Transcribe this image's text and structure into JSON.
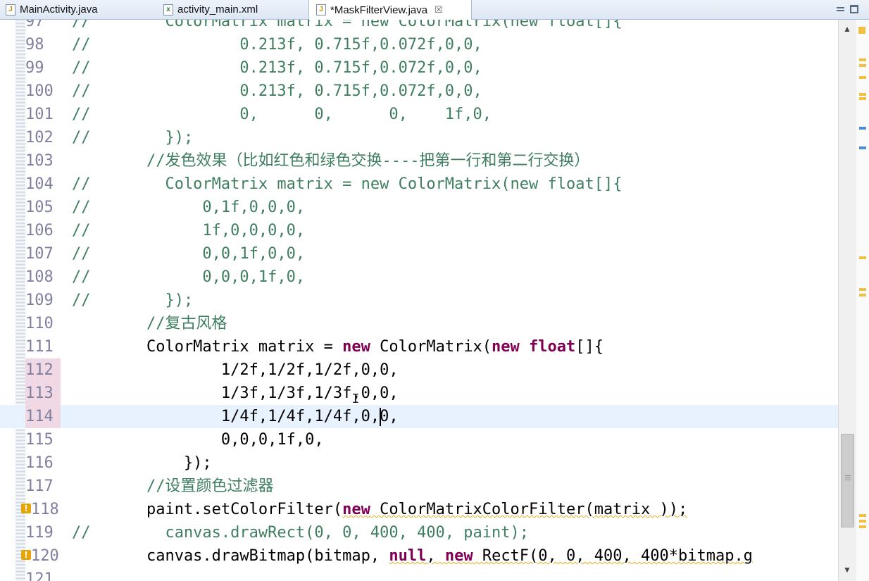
{
  "tabs": [
    {
      "label": "MainActivity.java",
      "icon": "java-file-icon",
      "active": false
    },
    {
      "label": "activity_main.xml",
      "icon": "xml-file-icon",
      "active": false
    },
    {
      "label": "*MaskFilterView.java",
      "icon": "java-file-icon",
      "active": true,
      "close_glyph": "☒"
    }
  ],
  "editor": {
    "font": "monospace",
    "colors": {
      "comment": "#3f7f5f",
      "keyword": "#7f0055",
      "current_line": "#e8f2fe",
      "line_number": "#7f7f9f"
    },
    "current_line_number": "114",
    "lines": [
      {
        "n": "97",
        "prefix": "//",
        "code": "        ColorMatrix matrix = new ColorMatrix(new float[]{"
      },
      {
        "n": "98",
        "prefix": "//",
        "code": "                0.213f, 0.715f,0.072f,0,0,"
      },
      {
        "n": "99",
        "prefix": "//",
        "code": "                0.213f, 0.715f,0.072f,0,0,"
      },
      {
        "n": "100",
        "prefix": "//",
        "code": "                0.213f, 0.715f,0.072f,0,0,"
      },
      {
        "n": "101",
        "prefix": "//",
        "code": "                0,      0,      0,    1f,0,"
      },
      {
        "n": "102",
        "prefix": "//",
        "code": "        });"
      },
      {
        "n": "103",
        "prefix": "",
        "code": "        //发色效果（比如红色和绿色交换----把第一行和第二行交换）"
      },
      {
        "n": "104",
        "prefix": "//",
        "code": "        ColorMatrix matrix = new ColorMatrix(new float[]{"
      },
      {
        "n": "105",
        "prefix": "//",
        "code": "            0,1f,0,0,0,"
      },
      {
        "n": "106",
        "prefix": "//",
        "code": "            1f,0,0,0,0,"
      },
      {
        "n": "107",
        "prefix": "//",
        "code": "            0,0,1f,0,0,"
      },
      {
        "n": "108",
        "prefix": "//",
        "code": "            0,0,0,1f,0,"
      },
      {
        "n": "109",
        "prefix": "//",
        "code": "        });"
      },
      {
        "n": "110",
        "prefix": "",
        "code": "        //复古风格"
      },
      {
        "n": "111",
        "prefix": "",
        "code_parts": [
          "        ColorMatrix matrix = ",
          "new",
          " ColorMatrix(",
          "new",
          " ",
          "float",
          "[]{"
        ]
      },
      {
        "n": "112",
        "prefix": "",
        "code": "                1/2f,1/2f,1/2f,0,0,"
      },
      {
        "n": "113",
        "prefix": "",
        "code": "                1/3f,1/3f,1/3f,0,0,"
      },
      {
        "n": "114",
        "prefix": "",
        "code": "                1/4f,1/4f,1/4f,0,0,"
      },
      {
        "n": "115",
        "prefix": "",
        "code": "                0,0,0,1f,0,"
      },
      {
        "n": "116",
        "prefix": "",
        "code": "            });"
      },
      {
        "n": "117",
        "prefix": "",
        "code": "        //设置颜色过滤器"
      },
      {
        "n": "118",
        "prefix": "",
        "code_parts": [
          "        paint.setColorFilter(",
          "new",
          " ColorMatrixColorFilter(matrix ));"
        ],
        "warning": true
      },
      {
        "n": "119",
        "prefix": "//",
        "code": "        canvas.drawRect(0, 0, 400, 400, paint);"
      },
      {
        "n": "120",
        "prefix": "",
        "code_parts": [
          "        canvas.drawBitmap(bitmap, ",
          "null",
          ", ",
          "new",
          " RectF(0, 0, 400, 400*bitmap.g"
        ],
        "warning": true
      },
      {
        "n": "121",
        "prefix": "",
        "code": ""
      }
    ]
  }
}
